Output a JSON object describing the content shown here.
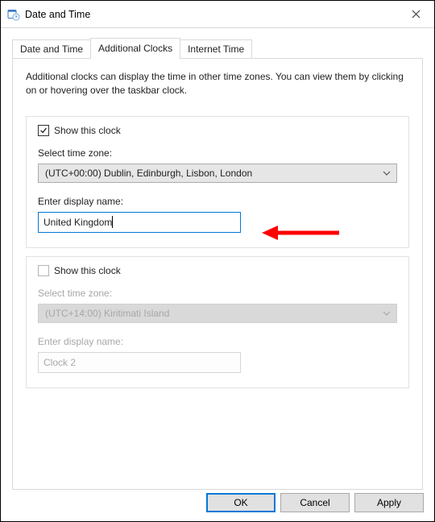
{
  "window": {
    "title": "Date and Time"
  },
  "tabs": {
    "dateTime": "Date and Time",
    "additionalClocks": "Additional Clocks",
    "internetTime": "Internet Time"
  },
  "description": "Additional clocks can display the time in other time zones. You can view them by clicking on or hovering over the taskbar clock.",
  "clock1": {
    "showLabel": "Show this clock",
    "showChecked": true,
    "tzLabel": "Select time zone:",
    "tzValue": "(UTC+00:00) Dublin, Edinburgh, Lisbon, London",
    "nameLabel": "Enter display name:",
    "nameValue": "United Kingdom"
  },
  "clock2": {
    "showLabel": "Show this clock",
    "showChecked": false,
    "tzLabel": "Select time zone:",
    "tzValue": "(UTC+14:00) Kiritimati Island",
    "nameLabel": "Enter display name:",
    "nameValue": "Clock 2"
  },
  "buttons": {
    "ok": "OK",
    "cancel": "Cancel",
    "apply": "Apply"
  }
}
